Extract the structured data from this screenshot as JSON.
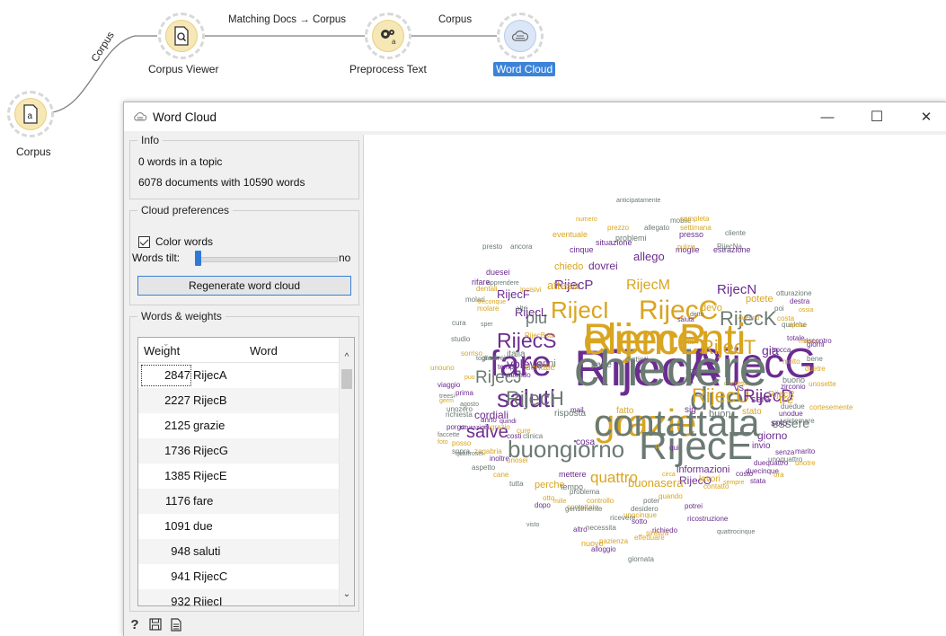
{
  "canvas": {
    "nodes": [
      {
        "id": "corpus",
        "label": "Corpus",
        "icon": "document-a-icon"
      },
      {
        "id": "corpus-viewer",
        "label": "Corpus Viewer",
        "icon": "document-search-icon"
      },
      {
        "id": "preprocess-text",
        "label": "Preprocess Text",
        "icon": "gears-icon"
      },
      {
        "id": "word-cloud",
        "label": "Word Cloud",
        "icon": "cloud-icon"
      }
    ],
    "links": [
      {
        "label": "Corpus"
      },
      {
        "label": "Matching Docs → Corpus"
      },
      {
        "label": "Corpus"
      }
    ]
  },
  "window": {
    "title": "Word Cloud",
    "minimize_glyph": "—",
    "maximize_glyph": "☐",
    "close_glyph": "✕"
  },
  "info": {
    "title": "Info",
    "line1": "0 words in a topic",
    "line2": "6078 documents with 10590 words"
  },
  "cloud_prefs": {
    "title": "Cloud preferences",
    "color_words_label": "Color words",
    "color_words_checked": true,
    "words_tilt_label": "Words tilt:",
    "words_tilt_value": "no",
    "regenerate_label": "Regenerate word cloud"
  },
  "weights": {
    "title": "Words & weights",
    "col_weight": "Weight",
    "col_word": "Word",
    "rows": [
      {
        "weight": "2847",
        "word": "RijecA"
      },
      {
        "weight": "2227",
        "word": "RijecB"
      },
      {
        "weight": "2125",
        "word": "grazie"
      },
      {
        "weight": "1736",
        "word": "RijecG"
      },
      {
        "weight": "1385",
        "word": "RijecE"
      },
      {
        "weight": "1176",
        "word": "fare"
      },
      {
        "weight": "1091",
        "word": "due"
      },
      {
        "weight": "948",
        "word": "saluti"
      },
      {
        "weight": "941",
        "word": "RijecC"
      },
      {
        "weight": "932",
        "word": "RijecI"
      }
    ]
  },
  "colors": {
    "gray": "#6b7a73",
    "purple": "#6b2c8f",
    "gold": "#d9a520",
    "accent": "#3b83d8"
  },
  "cloud_words": [
    {
      "t": "RijecA",
      "c": "purple"
    },
    {
      "t": "RijecB",
      "c": "gold"
    },
    {
      "t": "grazie",
      "c": "gold"
    },
    {
      "t": "RijecG",
      "c": "purple"
    },
    {
      "t": "RijecE",
      "c": "gray"
    },
    {
      "t": "fare",
      "c": "purple"
    },
    {
      "t": "due",
      "c": "gray"
    },
    {
      "t": "saluti",
      "c": "purple"
    },
    {
      "t": "RijecC",
      "c": "gold"
    },
    {
      "t": "RijecI",
      "c": "gold"
    },
    {
      "t": "buongiorno",
      "c": "gray"
    },
    {
      "t": "salve",
      "c": "purple"
    },
    {
      "t": "RijecS",
      "c": "purple"
    },
    {
      "t": "RijecT",
      "c": "gold"
    },
    {
      "t": "RijecH",
      "c": "gray"
    },
    {
      "t": "RijecU",
      "c": "gold"
    },
    {
      "t": "RijecK",
      "c": "gray"
    },
    {
      "t": "RijecJ",
      "c": "gray"
    },
    {
      "t": "RijecD",
      "c": "purple"
    },
    {
      "t": "piu",
      "c": "gray"
    },
    {
      "t": "quattro",
      "c": "gold"
    },
    {
      "t": "RijecM",
      "c": "gold"
    },
    {
      "t": "RijecP",
      "c": "purple"
    },
    {
      "t": "RijecN",
      "c": "purple"
    },
    {
      "t": "gia",
      "c": "purple"
    },
    {
      "t": "essere",
      "c": "gray"
    },
    {
      "t": "tre",
      "c": "gold"
    },
    {
      "t": "giorno",
      "c": "purple"
    },
    {
      "t": "volevo",
      "c": "purple"
    },
    {
      "t": "cordiali",
      "c": "purple"
    },
    {
      "t": "anni",
      "c": "gray"
    },
    {
      "t": "RijecF",
      "c": "purple"
    },
    {
      "t": "RijecO",
      "c": "purple"
    },
    {
      "t": "RijecL",
      "c": "purple"
    },
    {
      "t": "attesa",
      "c": "gold"
    },
    {
      "t": "dovrei",
      "c": "purple"
    },
    {
      "t": "allego",
      "c": "purple"
    },
    {
      "t": "devo",
      "c": "gold"
    },
    {
      "t": "potete",
      "c": "gold"
    },
    {
      "t": "chiedo",
      "c": "gold"
    },
    {
      "t": "perche",
      "c": "gold"
    },
    {
      "t": "buonasera",
      "c": "gold"
    },
    {
      "t": "informazioni",
      "c": "purple"
    },
    {
      "t": "risposta",
      "c": "gray"
    },
    {
      "t": "fatto",
      "c": "gold"
    },
    {
      "t": "RijecR",
      "c": "gold"
    },
    {
      "t": "stato",
      "c": "gold"
    },
    {
      "t": "invio",
      "c": "purple"
    },
    {
      "t": "lavori",
      "c": "gold"
    },
    {
      "t": "mail",
      "c": "purple"
    },
    {
      "t": "parte",
      "c": "gray"
    },
    {
      "t": "italia",
      "c": "gray"
    },
    {
      "t": "distinti",
      "c": "gray"
    },
    {
      "t": "dentale",
      "c": "gold"
    },
    {
      "t": "cosa",
      "c": "purple"
    },
    {
      "t": "tempo",
      "c": "gray"
    },
    {
      "t": "mettere",
      "c": "purple"
    },
    {
      "t": "buono",
      "c": "gray"
    },
    {
      "t": "solo",
      "c": "purple"
    },
    {
      "t": "cinque",
      "c": "purple"
    },
    {
      "t": "moglie",
      "c": "purple"
    },
    {
      "t": "estrazione",
      "c": "purple"
    },
    {
      "t": "presso",
      "c": "purple"
    },
    {
      "t": "problemi",
      "c": "gray"
    },
    {
      "t": "mobile",
      "c": "gray"
    },
    {
      "t": "situazione",
      "c": "purple"
    },
    {
      "t": "eventuale",
      "c": "gold"
    },
    {
      "t": "prezzo",
      "c": "gold"
    },
    {
      "t": "allegato",
      "c": "gray"
    },
    {
      "t": "settimana",
      "c": "gold"
    },
    {
      "t": "cliente",
      "c": "gray"
    },
    {
      "t": "ancora",
      "c": "gray"
    },
    {
      "t": "presto",
      "c": "gray"
    },
    {
      "t": "duesei",
      "c": "purple"
    },
    {
      "t": "rifare",
      "c": "purple"
    },
    {
      "t": "dentali",
      "c": "gold"
    },
    {
      "t": "molari",
      "c": "gray"
    },
    {
      "t": "incisivi",
      "c": "gold"
    },
    {
      "t": "molare",
      "c": "gold"
    },
    {
      "t": "altri",
      "c": "gray"
    },
    {
      "t": "cura",
      "c": "gray"
    },
    {
      "t": "studio",
      "c": "gray"
    },
    {
      "t": "RijecBsta",
      "c": "gold"
    },
    {
      "t": "sorriso",
      "c": "gold"
    },
    {
      "t": "gradirei",
      "c": "gray"
    },
    {
      "t": "tempi",
      "c": "purple"
    },
    {
      "t": "unouno",
      "c": "gold"
    },
    {
      "t": "attendo",
      "c": "purple"
    },
    {
      "t": "viaggio",
      "c": "purple"
    },
    {
      "t": "prima",
      "c": "purple"
    },
    {
      "t": "unozero",
      "c": "gray"
    },
    {
      "t": "richiesta",
      "c": "gray"
    },
    {
      "t": "anno",
      "c": "purple"
    },
    {
      "t": "ringrazio",
      "c": "gold"
    },
    {
      "t": "porgo",
      "c": "purple"
    },
    {
      "t": "cure",
      "c": "gold"
    },
    {
      "t": "costi",
      "c": "purple"
    },
    {
      "t": "clinica",
      "c": "gray"
    },
    {
      "t": "posso",
      "c": "gold"
    },
    {
      "t": "zagabria",
      "c": "gold"
    },
    {
      "t": "sopra",
      "c": "gray"
    },
    {
      "t": "inoltre",
      "c": "purple"
    },
    {
      "t": "unosei",
      "c": "gold"
    },
    {
      "t": "aspetto",
      "c": "gray"
    },
    {
      "t": "cane",
      "c": "gold"
    },
    {
      "t": "tutta",
      "c": "gray"
    },
    {
      "t": "otto",
      "c": "gold"
    },
    {
      "t": "problema",
      "c": "gray"
    },
    {
      "t": "dopo",
      "c": "purple"
    },
    {
      "t": "contattato",
      "c": "gold"
    },
    {
      "t": "controllo",
      "c": "gold"
    },
    {
      "t": "gentilmente",
      "c": "gray"
    },
    {
      "t": "poter",
      "c": "gray"
    },
    {
      "t": "desidero",
      "c": "gray"
    },
    {
      "t": "potrei",
      "c": "purple"
    },
    {
      "t": "ricostruzione",
      "c": "purple"
    },
    {
      "t": "sotto",
      "c": "purple"
    },
    {
      "t": "unocinque",
      "c": "gold"
    },
    {
      "t": "ricevere",
      "c": "gray"
    },
    {
      "t": "effettuare",
      "c": "gold"
    },
    {
      "t": "nuovo",
      "c": "gold"
    },
    {
      "t": "quando",
      "c": "gold"
    },
    {
      "t": "necessita",
      "c": "gray"
    },
    {
      "t": "richiedo",
      "c": "purple"
    },
    {
      "t": "alloggio",
      "c": "purple"
    },
    {
      "t": "giornata",
      "c": "gray"
    },
    {
      "t": "contatto",
      "c": "gold"
    },
    {
      "t": "stata",
      "c": "purple"
    },
    {
      "t": "duecinque",
      "c": "purple"
    },
    {
      "t": "costo",
      "c": "purple"
    },
    {
      "t": "ora",
      "c": "gold"
    },
    {
      "t": "unoquattro",
      "c": "gray"
    },
    {
      "t": "unotre",
      "c": "gold"
    },
    {
      "t": "duequattro",
      "c": "purple"
    },
    {
      "t": "senza",
      "c": "purple"
    },
    {
      "t": "marito",
      "c": "purple"
    },
    {
      "t": "sistemare",
      "c": "gray"
    },
    {
      "t": "unodue",
      "c": "purple"
    },
    {
      "t": "duedue",
      "c": "gray"
    },
    {
      "t": "cortesemente",
      "c": "gold"
    },
    {
      "t": "zirconio",
      "c": "purple"
    },
    {
      "t": "unosette",
      "c": "gold"
    },
    {
      "t": "duetre",
      "c": "gold"
    },
    {
      "t": "molto",
      "c": "gold"
    },
    {
      "t": "bene",
      "c": "gray"
    },
    {
      "t": "bocca",
      "c": "purple"
    },
    {
      "t": "giorni",
      "c": "purple"
    },
    {
      "t": "riscontro",
      "c": "purple"
    },
    {
      "t": "totale",
      "c": "purple"
    },
    {
      "t": "qualche",
      "c": "gray"
    },
    {
      "t": "costa",
      "c": "gold"
    },
    {
      "t": "poi",
      "c": "gray"
    },
    {
      "t": "destra",
      "c": "purple"
    },
    {
      "t": "otturazione",
      "c": "gray"
    },
    {
      "t": "RijecNa",
      "c": "gray"
    },
    {
      "t": "completa",
      "c": "gold"
    },
    {
      "t": "anticipatamente",
      "c": "gray"
    },
    {
      "t": "numero",
      "c": "gold"
    },
    {
      "t": "pulizia",
      "c": "gold"
    },
    {
      "t": "buon",
      "c": "gray"
    },
    {
      "t": "sera",
      "c": "purple"
    },
    {
      "t": "vs",
      "c": "purple"
    },
    {
      "t": "me",
      "c": "gray"
    },
    {
      "t": "fa",
      "c": "purple"
    },
    {
      "t": "sig",
      "c": "purple"
    },
    {
      "t": "via",
      "c": "gray"
    },
    {
      "t": "n",
      "c": "gold"
    },
    {
      "t": "qui",
      "c": "purple"
    },
    {
      "t": "circa",
      "c": "gold"
    },
    {
      "t": "visto",
      "c": "gray"
    },
    {
      "t": "mille",
      "c": "gold"
    },
    {
      "t": "altro",
      "c": "purple"
    },
    {
      "t": "pazienza",
      "c": "gold"
    },
    {
      "t": "sinistra",
      "c": "gold"
    },
    {
      "t": "quattrocinque",
      "c": "gray"
    },
    {
      "t": "sempre",
      "c": "gold"
    },
    {
      "t": "sette",
      "c": "gold"
    },
    {
      "t": "saluta",
      "c": "purple"
    },
    {
      "t": "detto",
      "c": "gray"
    },
    {
      "t": "duesette",
      "c": "gold"
    },
    {
      "t": "mando",
      "c": "gold"
    },
    {
      "t": "spesa",
      "c": "gold"
    },
    {
      "t": "dueuno",
      "c": "gold"
    },
    {
      "t": "ossia",
      "c": "gold"
    },
    {
      "t": "togliere",
      "c": "gray"
    },
    {
      "t": "apprendere",
      "c": "gray"
    },
    {
      "t": "treconque",
      "c": "gold"
    },
    {
      "t": "sper",
      "c": "gray"
    },
    {
      "t": "puo",
      "c": "gold"
    },
    {
      "t": "treesi",
      "c": "gray"
    },
    {
      "t": "germ",
      "c": "gold"
    },
    {
      "t": "agosto",
      "c": "gray"
    },
    {
      "t": "faccette",
      "c": "gray"
    },
    {
      "t": "foto",
      "c": "gold"
    },
    {
      "t": "otturazioni",
      "c": "purple"
    },
    {
      "t": "quindi",
      "c": "purple"
    },
    {
      "t": "quattrosei",
      "c": "gray"
    },
    {
      "t": "chiedere",
      "c": "gray"
    },
    {
      "t": "elementi",
      "c": "gold"
    },
    {
      "t": "contattata",
      "c": "gray"
    }
  ]
}
